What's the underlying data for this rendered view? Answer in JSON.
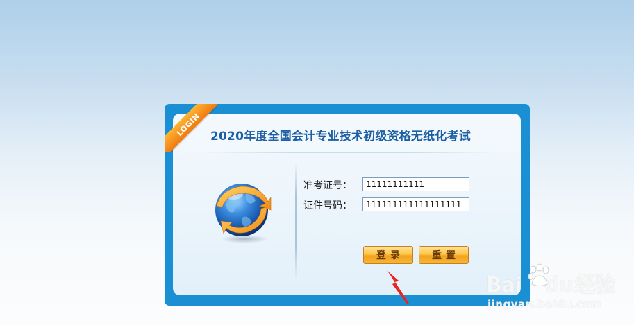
{
  "title": "2020年度全国会计专业技术初级资格无纸化考试",
  "ribbon": "LOGIN",
  "form": {
    "admission_label": "准考证号：",
    "admission_value": "11111111111",
    "id_label": "证件号码：",
    "id_value": "111111111111111111"
  },
  "buttons": {
    "login": "登录",
    "reset": "重置"
  },
  "watermark": {
    "brand_left": "Bai",
    "brand_right": "经验",
    "brand_du": "du",
    "url": "jingyan.baidu.com"
  },
  "colors": {
    "panel_border": "#1a8fd3",
    "title": "#1d5fa3",
    "ribbon": "#f39219",
    "button": "#ffc447",
    "arrow": "#e8261e"
  },
  "icons": {
    "globe": "globe-icon",
    "arrow": "red-arrow-annotation"
  }
}
